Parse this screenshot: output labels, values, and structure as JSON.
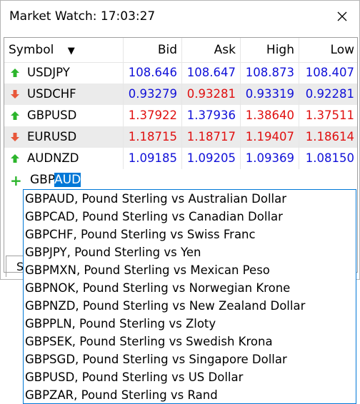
{
  "window": {
    "title": "Market Watch: 17:03:27",
    "close_glyph": "✕"
  },
  "table": {
    "headers": {
      "symbol": "Symbol",
      "sort_indicator": "▼",
      "bid": "Bid",
      "ask": "Ask",
      "high": "High",
      "low": "Low"
    },
    "rows": [
      {
        "symbol": "USDJPY",
        "direction": "up",
        "bid": "108.646",
        "ask": "108.647",
        "high": "108.873",
        "low": "108.407",
        "bid_color": "blue",
        "ask_color": "blue",
        "high_color": "blue",
        "low_color": "blue"
      },
      {
        "symbol": "USDCHF",
        "direction": "down",
        "bid": "0.93279",
        "ask": "0.93281",
        "high": "0.93319",
        "low": "0.92281",
        "bid_color": "blue",
        "ask_color": "red",
        "high_color": "blue",
        "low_color": "blue"
      },
      {
        "symbol": "GBPUSD",
        "direction": "up",
        "bid": "1.37922",
        "ask": "1.37936",
        "high": "1.38640",
        "low": "1.37511",
        "bid_color": "red",
        "ask_color": "blue",
        "high_color": "red",
        "low_color": "red"
      },
      {
        "symbol": "EURUSD",
        "direction": "down",
        "bid": "1.18715",
        "ask": "1.18717",
        "high": "1.19407",
        "low": "1.18614",
        "bid_color": "red",
        "ask_color": "red",
        "high_color": "red",
        "low_color": "red"
      },
      {
        "symbol": "AUDNZD",
        "direction": "up",
        "bid": "1.09185",
        "ask": "1.09205",
        "high": "1.09369",
        "low": "1.08150",
        "bid_color": "blue",
        "ask_color": "blue",
        "high_color": "blue",
        "low_color": "blue"
      }
    ],
    "add_symbol": {
      "icon": "+",
      "typed": "GBP",
      "autocomplete": "AUD"
    }
  },
  "tab_peek": "S",
  "dropdown": {
    "options": [
      "GBPAUD, Pound Sterling vs Australian Dollar",
      "GBPCAD, Pound Sterling vs Canadian Dollar",
      "GBPCHF, Pound Sterling vs Swiss Franc",
      "GBPJPY, Pound Sterling vs Yen",
      "GBPMXN, Pound Sterling vs Mexican Peso",
      "GBPNOK, Pound Sterling vs Norwegian Krone",
      "GBPNZD, Pound Sterling vs New Zealand Dollar",
      "GBPPLN, Pound Sterling vs Zloty",
      "GBPSEK, Pound Sterling vs Swedish Krona",
      "GBPSGD, Pound Sterling vs Singapore Dollar",
      "GBPUSD, Pound Sterling vs US Dollar",
      "GBPZAR, Pound Sterling vs Rand"
    ]
  },
  "colors": {
    "up": "#2cb52c",
    "down": "#e8573a",
    "blue": "#1010d8",
    "red": "#e01010",
    "accent": "#0078d7"
  }
}
